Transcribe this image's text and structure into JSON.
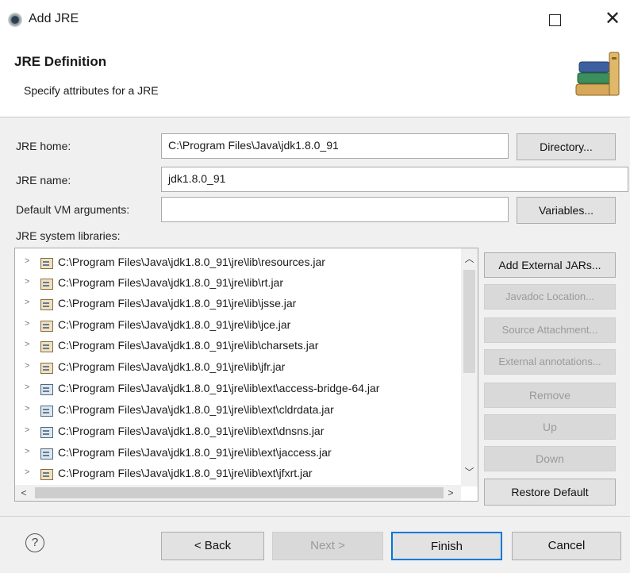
{
  "window": {
    "title": "Add JRE",
    "close_glyph": "✕"
  },
  "header": {
    "title": "JRE Definition",
    "subtitle": "Specify attributes for a JRE",
    "icon": "books-icon"
  },
  "form": {
    "jre_home_label": "JRE home:",
    "jre_home_value": "C:\\Program Files\\Java\\jdk1.8.0_91",
    "directory_button": "Directory...",
    "jre_name_label": "JRE name:",
    "jre_name_value": "jdk1.8.0_91",
    "vm_args_label": "Default VM arguments:",
    "vm_args_value": "",
    "variables_button": "Variables...",
    "libraries_label": "JRE system libraries:"
  },
  "libraries": [
    "C:\\Program Files\\Java\\jdk1.8.0_91\\jre\\lib\\resources.jar",
    "C:\\Program Files\\Java\\jdk1.8.0_91\\jre\\lib\\rt.jar",
    "C:\\Program Files\\Java\\jdk1.8.0_91\\jre\\lib\\jsse.jar",
    "C:\\Program Files\\Java\\jdk1.8.0_91\\jre\\lib\\jce.jar",
    "C:\\Program Files\\Java\\jdk1.8.0_91\\jre\\lib\\charsets.jar",
    "C:\\Program Files\\Java\\jdk1.8.0_91\\jre\\lib\\jfr.jar",
    "C:\\Program Files\\Java\\jdk1.8.0_91\\jre\\lib\\ext\\access-bridge-64.jar",
    "C:\\Program Files\\Java\\jdk1.8.0_91\\jre\\lib\\ext\\cldrdata.jar",
    "C:\\Program Files\\Java\\jdk1.8.0_91\\jre\\lib\\ext\\dnsns.jar",
    "C:\\Program Files\\Java\\jdk1.8.0_91\\jre\\lib\\ext\\jaccess.jar",
    "C:\\Program Files\\Java\\jdk1.8.0_91\\jre\\lib\\ext\\jfxrt.jar"
  ],
  "side_buttons": {
    "add_external": "Add External JARs...",
    "javadoc": "Javadoc Location...",
    "source": "Source Attachment...",
    "annotations": "External annotations...",
    "remove": "Remove",
    "up": "Up",
    "down": "Down",
    "restore": "Restore Default"
  },
  "footer": {
    "help": "?",
    "back": "< Back",
    "next": "Next >",
    "finish": "Finish",
    "cancel": "Cancel"
  },
  "colors": {
    "accent_border": "#0078d7",
    "disabled_text": "#9a9a9a"
  }
}
